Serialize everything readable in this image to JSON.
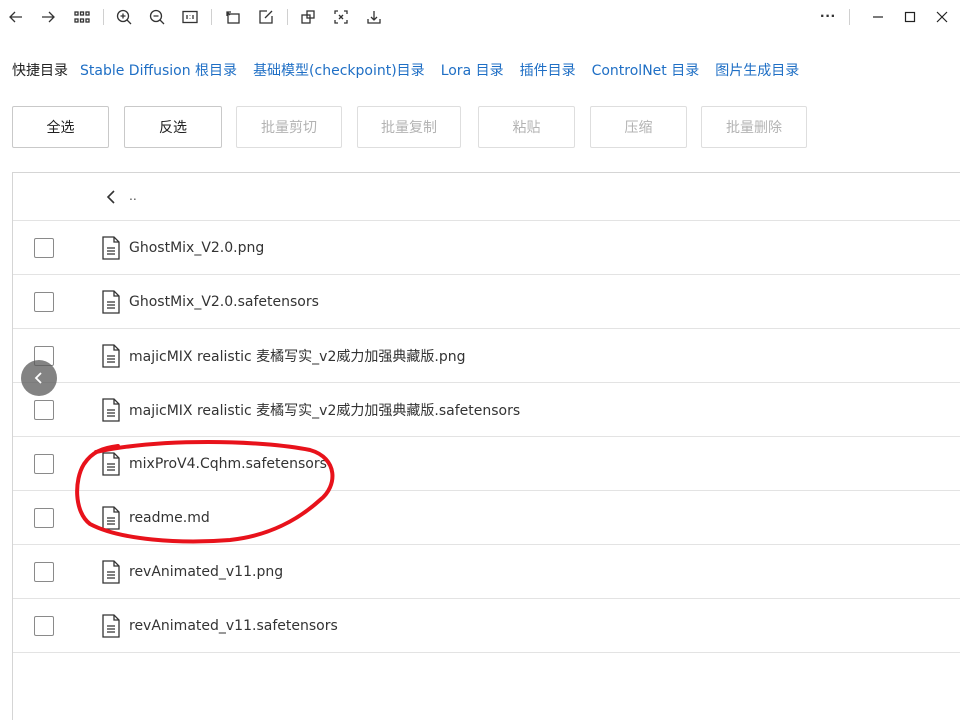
{
  "toolbar": {
    "icons": [
      "back-arrow-icon",
      "forward-arrow-icon",
      "grid-icon",
      "zoom-in-icon",
      "zoom-out-icon",
      "actual-size-icon",
      "rotate-icon",
      "edit-icon",
      "crop-icon",
      "fullscreen-icon",
      "download-icon"
    ],
    "more": "···"
  },
  "quick_links": {
    "label": "快捷目录",
    "items": [
      "Stable Diffusion 根目录",
      "基础模型(checkpoint)目录",
      "Lora 目录",
      "插件目录",
      "ControlNet 目录",
      "图片生成目录"
    ]
  },
  "actions": {
    "select_all": "全选",
    "invert": "反选",
    "batch_cut": "批量剪切",
    "batch_copy": "批量复制",
    "paste": "粘贴",
    "compress": "压缩",
    "batch_delete": "批量删除"
  },
  "file_list": {
    "parent": "..",
    "files": [
      "GhostMix_V2.0.png",
      "GhostMix_V2.0.safetensors",
      "majicMIX realistic 麦橘写实_v2威力加强典藏版.png",
      "majicMIX realistic 麦橘写实_v2威力加强典藏版.safetensors",
      "mixProV4.Cqhm.safetensors",
      "readme.md",
      "revAnimated_v11.png",
      "revAnimated_v11.safetensors"
    ]
  },
  "colors": {
    "link": "#1f6fc5",
    "annotation": "#e8121b",
    "disabled_text": "#b3b3b3"
  }
}
